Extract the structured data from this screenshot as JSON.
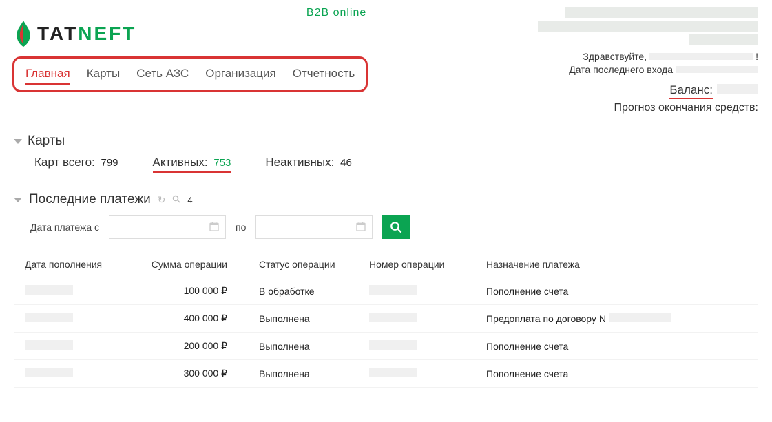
{
  "logo": {
    "b2b": "B2B online",
    "part1": "TAT",
    "part2": "NEFT"
  },
  "nav": {
    "items": [
      {
        "label": "Главная",
        "active": true
      },
      {
        "label": "Карты",
        "active": false
      },
      {
        "label": "Сеть АЗС",
        "active": false
      },
      {
        "label": "Организация",
        "active": false
      },
      {
        "label": "Отчетность",
        "active": false
      }
    ]
  },
  "user": {
    "hello": "Здравствуйте,",
    "hello_end": "!",
    "last_login": "Дата последнего входа",
    "balance_label": "Баланс:",
    "forecast": "Прогноз окончания средств:"
  },
  "cards": {
    "title": "Карты",
    "total_label": "Карт всего:",
    "total_val": "799",
    "active_label": "Активных:",
    "active_val": "753",
    "inactive_label": "Неактивных:",
    "inactive_val": "46"
  },
  "payments": {
    "title": "Последние платежи",
    "count": "4",
    "from_label": "Дата платежа с",
    "to_label": "по",
    "headers": {
      "date": "Дата пополнения",
      "amount": "Сумма операции",
      "status": "Статус операции",
      "number": "Номер операции",
      "purpose": "Назначение платежа"
    },
    "rows": [
      {
        "amount": "100 000 ₽",
        "status": "В обработке",
        "purpose": "Пополнение счета"
      },
      {
        "amount": "400 000 ₽",
        "status": "Выполнена",
        "purpose": "Предоплата по договору N"
      },
      {
        "amount": "200 000 ₽",
        "status": "Выполнена",
        "purpose": "Пополнение счета"
      },
      {
        "amount": "300 000 ₽",
        "status": "Выполнена",
        "purpose": "Пополнение счета"
      }
    ]
  }
}
